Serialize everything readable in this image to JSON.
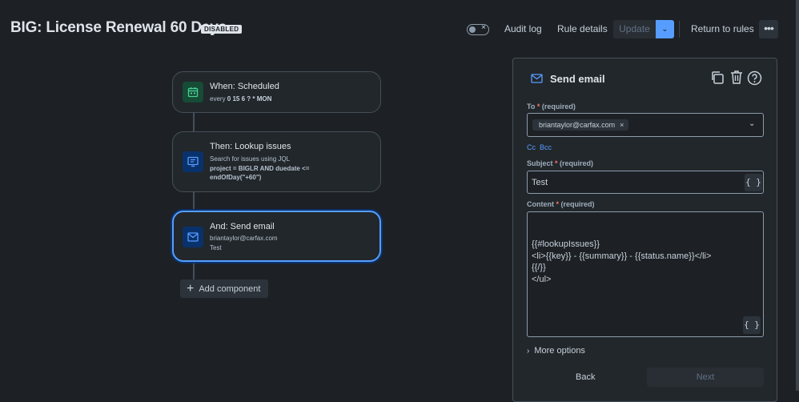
{
  "header": {
    "title": "BIG: License Renewal 60 Days",
    "status_badge": "DISABLED",
    "toggle_icon": "close-icon",
    "audit_log": "Audit log",
    "rule_details": "Rule details",
    "update": "Update",
    "return_to_rules": "Return to rules",
    "more_icon": "more-icon"
  },
  "flow": {
    "trigger": {
      "title": "When: Scheduled",
      "sub_prefix": "every",
      "schedule": "0 15 6 ? * MON",
      "icon": "calendar-icon"
    },
    "lookup": {
      "title": "Then: Lookup issues",
      "sub": "Search for issues using JQL",
      "jql": "project = BIGLR AND duedate <= endOfDay(\"+60\")",
      "icon": "search-issues-icon"
    },
    "send_email": {
      "title": "And: Send email",
      "recipient": "briantaylor@carfax.com",
      "subject": "Test",
      "icon": "email-icon"
    },
    "add_component": "Add component"
  },
  "panel": {
    "title": "Send email",
    "to_label": "To",
    "to_required": "(required)",
    "to_value": "briantaylor@carfax.com",
    "cc": "Cc",
    "bcc": "Bcc",
    "subject_label": "Subject",
    "subject_required": "(required)",
    "subject_value": "Test",
    "content_label": "Content",
    "content_required": "(required)",
    "content_lines": [
      "{{#lookupIssues}}",
      "<li>{{key}} - {{summary}} - {{status.name}}</li>",
      "{{/}}",
      "</ul>"
    ],
    "more_options": "More options",
    "back": "Back",
    "next": "Next"
  },
  "colors": {
    "background": "#1d2125",
    "accent": "#579dff",
    "required": "#f87168"
  }
}
